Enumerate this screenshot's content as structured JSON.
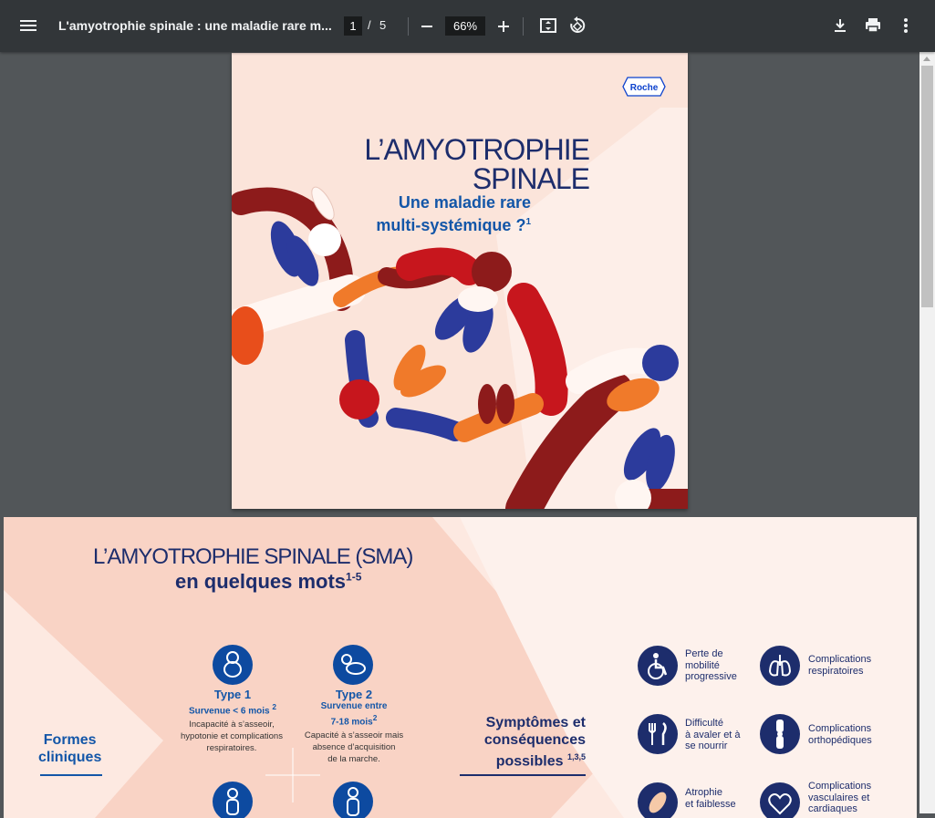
{
  "toolbar": {
    "title": "L'amyotrophie spinale : une maladie rare m...",
    "current_page": "1",
    "page_separator": "/",
    "total_pages": "5",
    "zoom": "66%"
  },
  "page1": {
    "logo": "Roche",
    "title_line1": "L’AMYOTROPHIE",
    "title_line2": "SPINALE",
    "subtitle_line1": "Une maladie rare",
    "subtitle_line2": "multi-systémique ?",
    "subtitle_ref": "1"
  },
  "page2": {
    "title_line1": "L’AMYOTROPHIE SPINALE (SMA)",
    "title_line2": "en quelques mots",
    "title_ref": "1-5",
    "formes_line1": "Formes",
    "formes_line2": "cliniques",
    "types": [
      {
        "title": "Type 1",
        "sub": "Survenue < 6 mois",
        "sub_ref": "2",
        "desc_line1": "Incapacité à s’asseoir,",
        "desc_line2": "hypotonie et complications",
        "desc_line3": "respiratoires."
      },
      {
        "title": "Type 2",
        "sub_line1": "Survenue entre",
        "sub_line2": "7-18 mois",
        "sub_ref": "2",
        "desc_line1": "Capacité à s’asseoir mais",
        "desc_line2": "absence d’acquisition",
        "desc_line3": "de la marche."
      }
    ],
    "symptomes_line1": "Symptômes et",
    "symptomes_line2": "conséquences",
    "symptomes_line3": "possibles",
    "symptomes_ref": "1,3,5",
    "symptoms": [
      {
        "l1": "Perte de",
        "l2": "mobilité",
        "l3": "progressive"
      },
      {
        "l1": "Complications",
        "l2": "respiratoires"
      },
      {
        "l1": "Difficulté",
        "l2": "à avaler et à",
        "l3": "se nourrir"
      },
      {
        "l1": "Complications",
        "l2": "orthopédiques"
      },
      {
        "l1": "Atrophie",
        "l2": "et faiblesse"
      },
      {
        "l1": "Complications",
        "l2": "vasculaires et",
        "l3": "cardiaques"
      }
    ]
  },
  "colors": {
    "toolbar": "#323639",
    "viewer_bg": "#525659",
    "navy": "#1d2d6c",
    "blue": "#1356a8",
    "page_bg": "#fbe4da"
  },
  "icons": [
    "menu-icon",
    "minus-icon",
    "plus-icon",
    "fit-page-icon",
    "rotate-icon",
    "download-icon",
    "print-icon",
    "more-vert-icon"
  ]
}
